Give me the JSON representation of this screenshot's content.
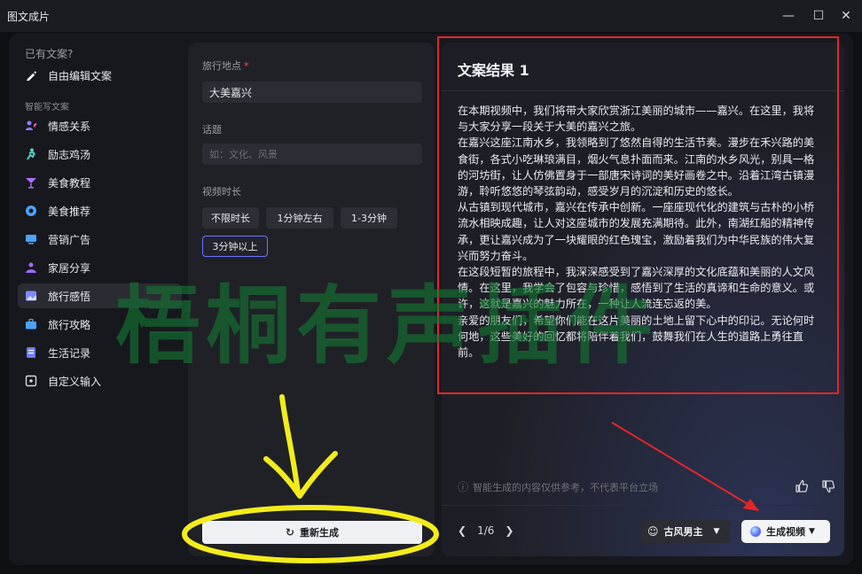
{
  "window": {
    "title": "图文成片",
    "minimize_icon": "minimize-icon",
    "maximize_icon": "maximize-icon",
    "close_icon": "close-icon"
  },
  "sidebar": {
    "existing_heading": "已有文案?",
    "free_edit": "自由编辑文案",
    "smart_heading": "智能写文案",
    "items": [
      {
        "label": "情感关系",
        "icon": "people-heart-icon",
        "color": "#8a7dff"
      },
      {
        "label": "励志鸡汤",
        "icon": "runner-icon",
        "color": "#4fd1c5"
      },
      {
        "label": "美食教程",
        "icon": "cocktail-icon",
        "color": "#b06cff"
      },
      {
        "label": "美食推荐",
        "icon": "food-icon",
        "color": "#4aa3ff"
      },
      {
        "label": "营销广告",
        "icon": "ad-monitor-icon",
        "color": "#4aa3ff"
      },
      {
        "label": "家居分享",
        "icon": "home-share-icon",
        "color": "#a46bff"
      },
      {
        "label": "旅行感悟",
        "icon": "travel-photo-icon",
        "color": "#7e8bff"
      },
      {
        "label": "旅行攻略",
        "icon": "suitcase-icon",
        "color": "#4aa3ff"
      },
      {
        "label": "生活记录",
        "icon": "life-book-icon",
        "color": "#6c7cff"
      },
      {
        "label": "自定义输入",
        "icon": "custom-input-icon",
        "color": "#d8d8e0"
      }
    ],
    "active_index": 6
  },
  "form": {
    "location_label": "旅行地点",
    "location_required": "*",
    "location_value": "大美嘉兴",
    "topic_label": "话题",
    "topic_placeholder": "如：文化、风景",
    "duration_label": "视频时长",
    "duration_options": [
      "不限时长",
      "1分钟左右",
      "1-3分钟",
      "3分钟以上"
    ],
    "duration_selected_index": 3,
    "regenerate_label": "重新生成"
  },
  "result": {
    "title": "文案结果 1",
    "paragraphs": [
      "在本期视频中，我们将带大家欣赏浙江美丽的城市——嘉兴。在这里，我将与大家分享一段关于大美的嘉兴之旅。",
      "在嘉兴这座江南水乡，我领略到了悠然自得的生活节奏。漫步在禾兴路的美食街，各式小吃琳琅满目，烟火气息扑面而来。江南的水乡风光，别具一格的河坊街，让人仿佛置身于一部唐宋诗词的美好画卷之中。沿着江湾古镇漫游，聆听悠悠的琴弦韵动，感受岁月的沉淀和历史的悠长。",
      "从古镇到现代城市，嘉兴在传承中创新。一座座现代化的建筑与古朴的小桥流水相映成趣，让人对这座城市的发展充满期待。此外，南湖红船的精神传承，更让嘉兴成为了一块耀眼的红色瑰宝，激励着我们为中华民族的伟大复兴而努力奋斗。",
      "在这段短暂的旅程中，我深深感受到了嘉兴深厚的文化底蕴和美丽的人文风情。在这里，我学会了包容与珍惜，感悟到了生活的真谛和生命的意义。或许，这就是嘉兴的魅力所在，一种让人流连忘返的美。",
      "亲爱的朋友们，希望你们能在这片美丽的土地上留下心中的印记。无论何时何地，这些美好的回忆都将陪伴着我们，鼓舞我们在人生的道路上勇往直前。"
    ],
    "disclaimer": "智能生成的内容仅供参考，不代表平台立场",
    "page_indicator": "1/6",
    "voice_label": "古风男主",
    "generate_video_label": "生成视频"
  },
  "overlay": {
    "watermark_text": "梧桐有声插件",
    "red_box_color": "#e3262a",
    "yellow_annotation_color": "#f3ec1c",
    "red_arrow_color": "#e3262a"
  }
}
